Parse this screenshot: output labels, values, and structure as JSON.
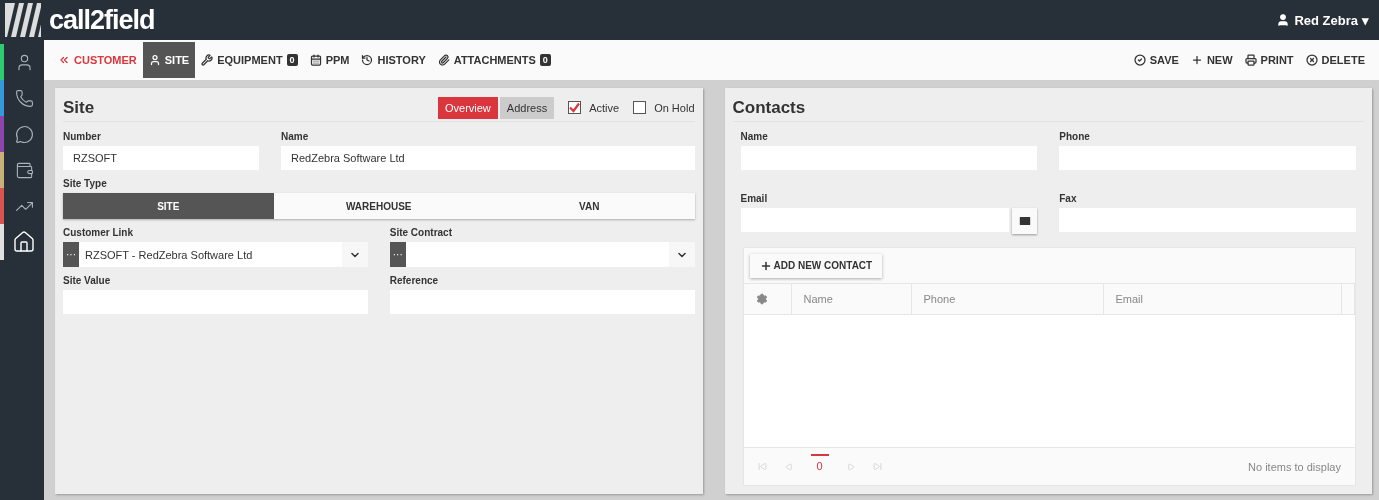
{
  "header": {
    "logo": "call2field",
    "user": "Red Zebra",
    "caret": "▾"
  },
  "sidebar": {
    "items": [
      {
        "color": "#2ecc71",
        "selected": false
      },
      {
        "color": "#3498db",
        "selected": false
      },
      {
        "color": "#8e44ad",
        "selected": false
      },
      {
        "color": "#c8b07a",
        "selected": false
      },
      {
        "color": "#d9534f",
        "selected": false
      },
      {
        "color": "#e0e0e0",
        "selected": true
      }
    ]
  },
  "toolbar": {
    "tabs": [
      {
        "label": "CUSTOMER",
        "kind": "back",
        "selected": false
      },
      {
        "label": "SITE",
        "kind": "tab",
        "selected": true
      },
      {
        "label": "EQUIPMENT",
        "kind": "tab",
        "selected": false,
        "badge": "0"
      },
      {
        "label": "PPM",
        "kind": "tab",
        "selected": false
      },
      {
        "label": "HISTORY",
        "kind": "tab",
        "selected": false
      },
      {
        "label": "ATTACHMENTS",
        "kind": "tab",
        "selected": false,
        "badge": "0"
      }
    ],
    "actions": [
      "SAVE",
      "NEW",
      "PRINT",
      "DELETE"
    ]
  },
  "site": {
    "title": "Site",
    "views": [
      {
        "label": "Overview",
        "selected": true
      },
      {
        "label": "Address",
        "selected": false
      }
    ],
    "flags": [
      {
        "label": "Active",
        "checked": true
      },
      {
        "label": "On Hold",
        "checked": false
      }
    ],
    "number": {
      "label": "Number",
      "value": "RZSOFT"
    },
    "name": {
      "label": "Name",
      "value": "RedZebra Software Ltd"
    },
    "site_type": {
      "label": "Site Type",
      "options": [
        {
          "label": "SITE",
          "selected": true
        },
        {
          "label": "WAREHOUSE",
          "selected": false
        },
        {
          "label": "VAN",
          "selected": false
        }
      ]
    },
    "customer_link": {
      "label": "Customer Link",
      "value": "RZSOFT - RedZebra Software Ltd",
      "picker": "···"
    },
    "site_contract": {
      "label": "Site Contract",
      "picker": "···"
    },
    "site_value": {
      "label": "Site Value"
    },
    "reference": {
      "label": "Reference"
    }
  },
  "contacts": {
    "title": "Contacts",
    "fields": [
      {
        "label": "Name",
        "kind": "text"
      },
      {
        "label": "Phone",
        "kind": "text"
      },
      {
        "label": "Email",
        "kind": "email"
      },
      {
        "label": "Fax",
        "kind": "text"
      }
    ],
    "grid": {
      "add_button": "ADD NEW CONTACT",
      "columns": [
        "Name",
        "Phone",
        "Email"
      ],
      "page": "0",
      "empty": "No items to display"
    }
  }
}
